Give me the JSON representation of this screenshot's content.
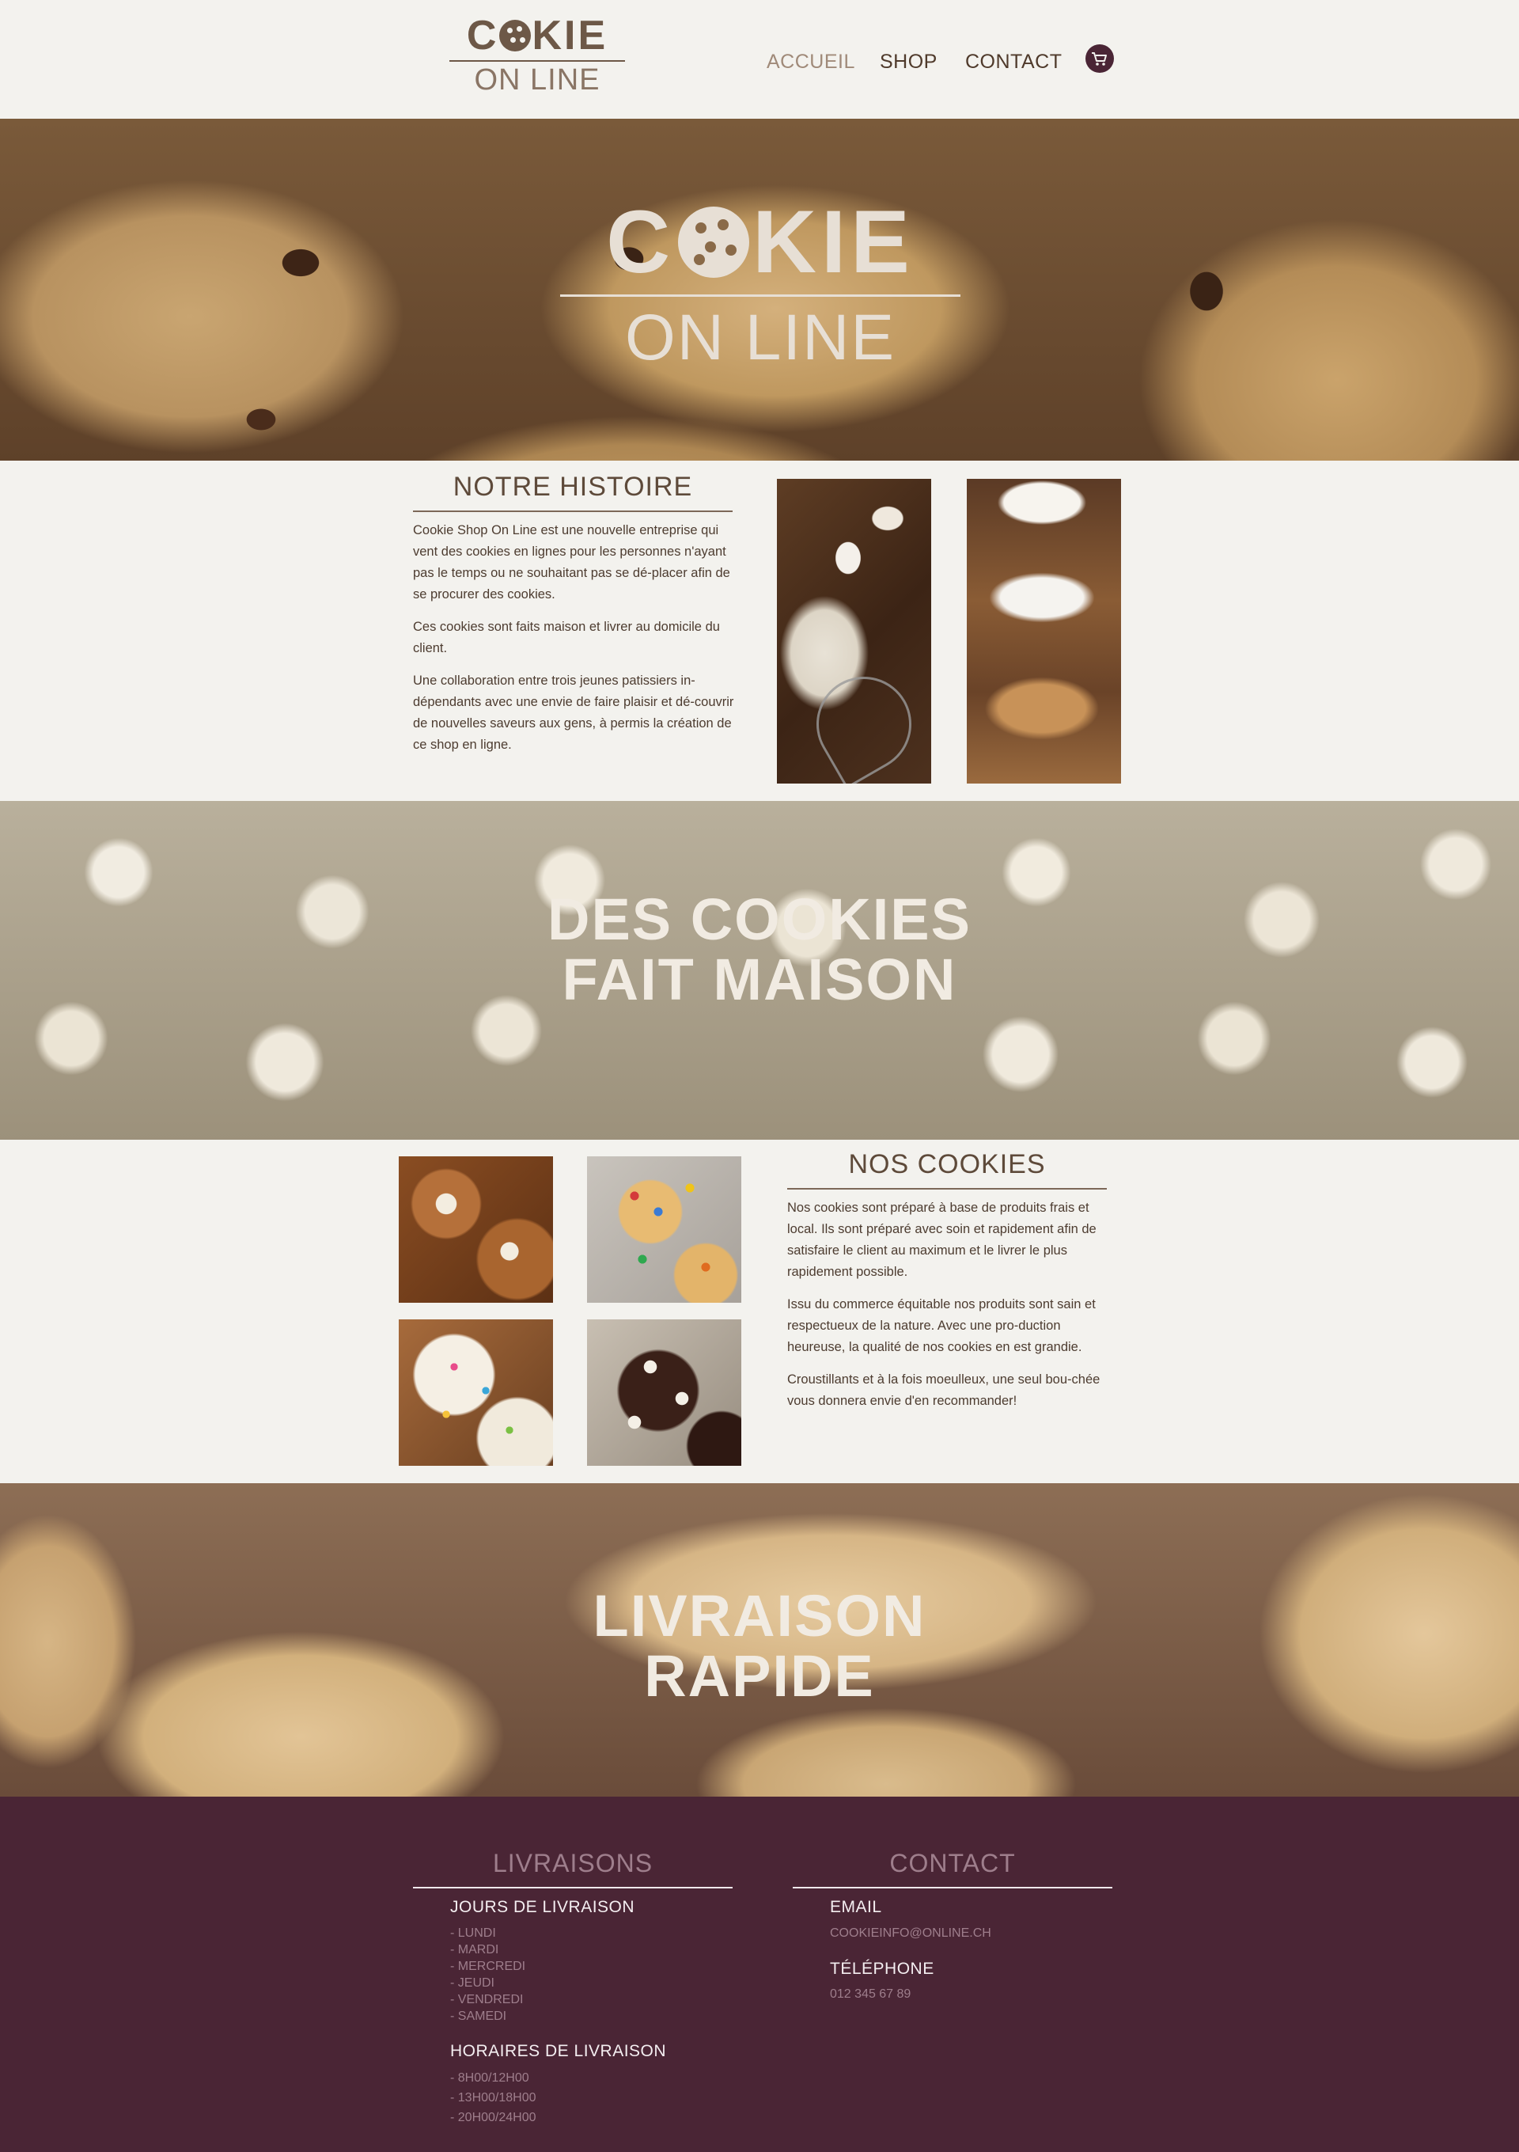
{
  "header": {
    "logo_word": "COOKIE",
    "logo_sub": "ON LINE",
    "nav": [
      "ACCUEIL",
      "SHOP",
      "CONTACT"
    ],
    "active_nav": "ACCUEIL"
  },
  "hero": {
    "logo_word": "COOKIE",
    "logo_sub": "ON LINE"
  },
  "histoire": {
    "title": "NOTRE HISTOIRE",
    "paragraphs": [
      "Cookie Shop On Line est une nouvelle entreprise qui vent des cookies en lignes pour les personnes n'ayant pas le temps ou ne souhaitant pas se dé-placer afin de se procurer des cookies.",
      "Ces cookies sont faits maison et livrer au domicile du client.",
      "Une collaboration entre trois jeunes patissiers in-dépendants avec une envie de faire plaisir et dé-couvrir de nouvelles saveurs aux gens, à permis la création de ce shop en ligne."
    ]
  },
  "banner_maison": {
    "line1": "DES COOKIES",
    "line2": "FAIT MAISON"
  },
  "nos_cookies": {
    "title": "NOS COOKIES",
    "paragraphs": [
      "Nos cookies sont préparé à base de produits frais et local. Ils sont préparé avec soin et rapidement afin de satisfaire le client au maximum et le livrer le plus rapidement possible.",
      "Issu du commerce équitable nos produits sont sain et respectueux de la nature. Avec une pro-duction heureuse, la qualité de nos cookies en est grandie.",
      "Croustillants et à la fois moeulleux, une seul bou-chée vous donnera envie d'en recommander!"
    ]
  },
  "banner_livraison": {
    "line1": "LIVRAISON",
    "line2": "RAPIDE"
  },
  "footer": {
    "livraisons": {
      "title": "LIVRAISONS",
      "jours_title": "JOURS DE LIVRAISON",
      "jours": [
        "- LUNDI",
        "- MARDI",
        "- MERCREDI",
        "- JEUDI",
        "- VENDREDI",
        "- SAMEDI"
      ],
      "horaires_title": "HORAIRES DE LIVRAISON",
      "horaires": [
        "- 8H00/12H00",
        "- 13H00/18H00",
        "- 20H00/24H00"
      ]
    },
    "contact": {
      "title": "CONTACT",
      "email_label": "EMAIL",
      "email": "COOKIEINFO@ONLINE.CH",
      "phone_label": "TÉLÉPHONE",
      "phone": "012 345 67 89"
    }
  },
  "colors": {
    "background": "#f3f2ee",
    "brown_text": "#5e4a3a",
    "footer_bg": "#4a2535",
    "footer_muted": "#9e7e8c"
  }
}
